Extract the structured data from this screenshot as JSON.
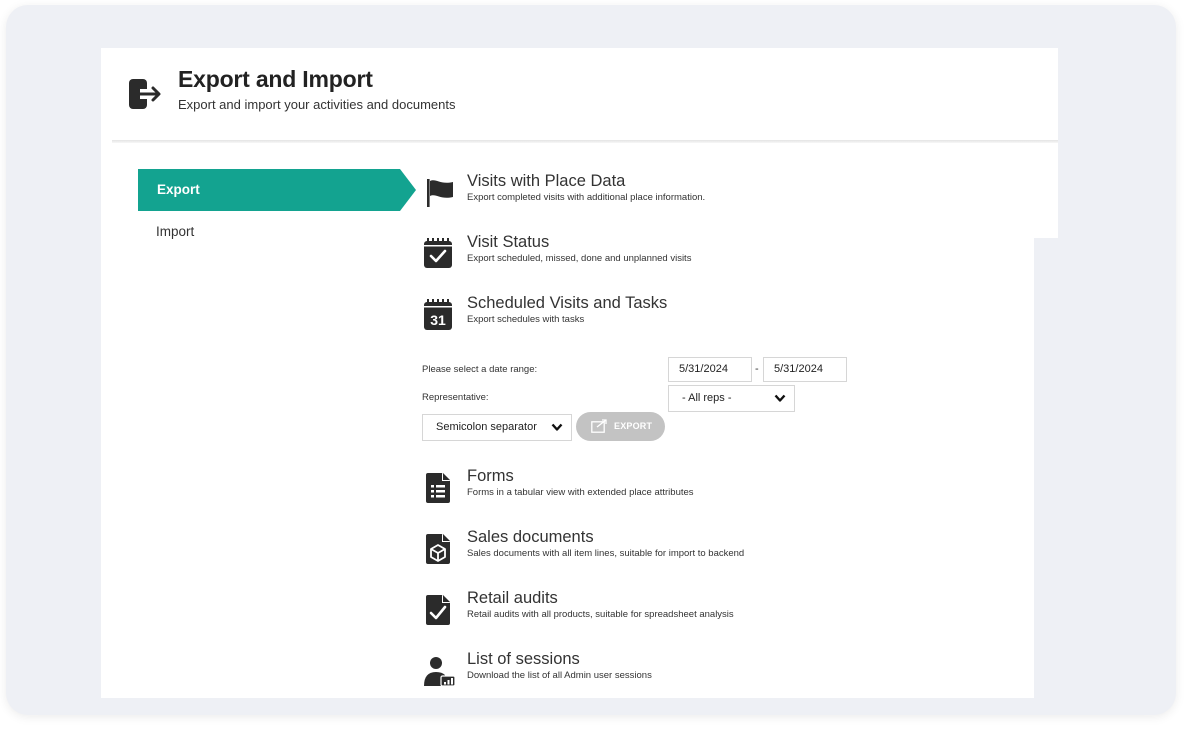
{
  "header": {
    "icon": "export-import-icon",
    "title": "Export and Import",
    "subtitle": "Export and import your activities and documents"
  },
  "nav": {
    "export_label": "Export",
    "import_label": "Import",
    "accent_color": "#13a390"
  },
  "items": [
    {
      "icon": "flag-icon",
      "title": "Visits with Place Data",
      "desc": "Export completed visits with additional place information."
    },
    {
      "icon": "calendar-check-icon",
      "title": "Visit Status",
      "desc": "Export scheduled, missed, done and unplanned visits"
    },
    {
      "icon": "calendar-31-icon",
      "icon_text": "31",
      "title": "Scheduled Visits and Tasks",
      "desc": "Export schedules with tasks"
    },
    {
      "icon": "list-document-icon",
      "title": "Forms",
      "desc": "Forms in a tabular view with extended place attributes"
    },
    {
      "icon": "box-document-icon",
      "title": "Sales documents",
      "desc": "Sales documents with all item lines, suitable for import to backend"
    },
    {
      "icon": "check-document-icon",
      "title": "Retail audits",
      "desc": "Retail audits with all products, suitable for spreadsheet analysis"
    },
    {
      "icon": "user-chart-icon",
      "title": "List of sessions",
      "desc": "Download the list of all Admin user sessions"
    }
  ],
  "form": {
    "date_range_label": "Please select a date range:",
    "date_from": "5/31/2024",
    "date_separator": "-",
    "date_to": "5/31/2024",
    "representative_label": "Representative:",
    "representative_value": "- All reps -",
    "separator_value": "Semicolon separator",
    "export_button": "EXPORT"
  }
}
